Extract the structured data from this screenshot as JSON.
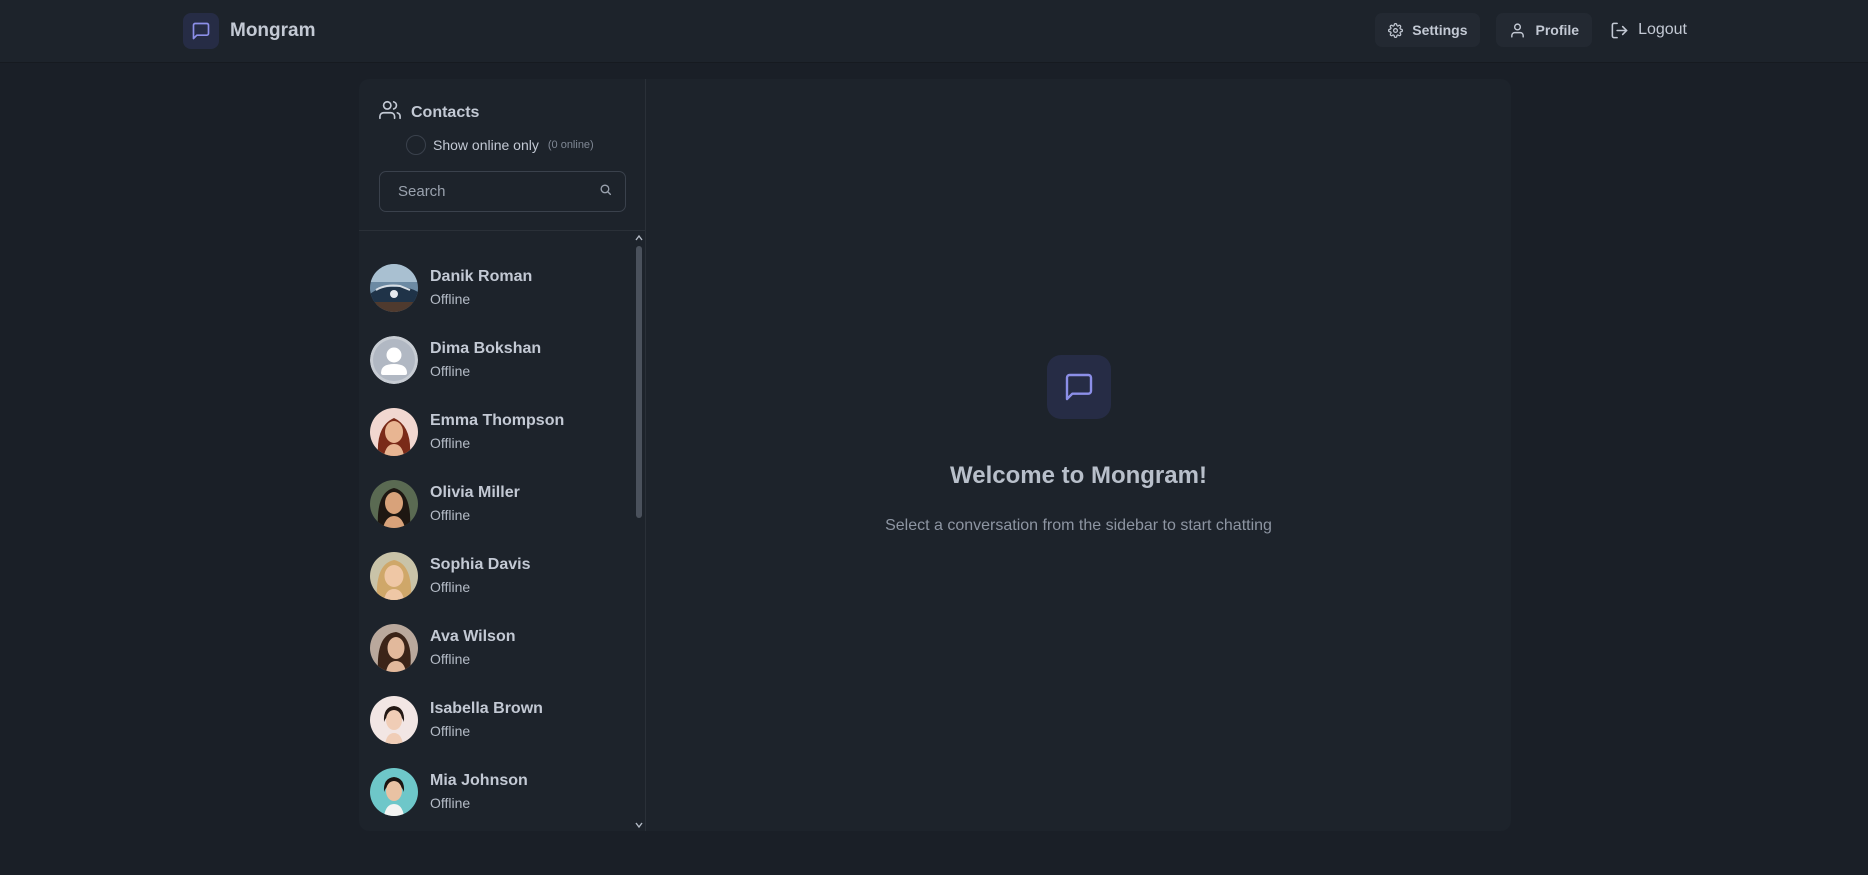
{
  "app": {
    "name": "Mongram",
    "accent_color": "#8c8fe8",
    "icon": "message-square-icon"
  },
  "navbar": {
    "settings": {
      "label": "Settings",
      "icon": "gear-icon"
    },
    "profile": {
      "label": "Profile",
      "icon": "user-icon"
    },
    "logout": {
      "label": "Logout",
      "icon": "logout-icon"
    }
  },
  "sidebar": {
    "title": "Contacts",
    "title_icon": "users-icon",
    "online_filter": {
      "label": "Show online only",
      "count": "(0 online)",
      "checked": false
    },
    "search": {
      "placeholder": "Search",
      "value": "",
      "icon": "search-icon"
    },
    "contacts": [
      {
        "name": "Danik Roman",
        "status": "Offline",
        "avatar": "photo-car"
      },
      {
        "name": "Dima Bokshan",
        "status": "Offline",
        "avatar": "default-user-avatar"
      },
      {
        "name": "Emma Thompson",
        "status": "Offline",
        "avatar": "photo-woman-red-hair"
      },
      {
        "name": "Olivia Miller",
        "status": "Offline",
        "avatar": "photo-woman-dark-hair"
      },
      {
        "name": "Sophia Davis",
        "status": "Offline",
        "avatar": "photo-woman-blonde"
      },
      {
        "name": "Ava Wilson",
        "status": "Offline",
        "avatar": "photo-woman-brown-hair"
      },
      {
        "name": "Isabella Brown",
        "status": "Offline",
        "avatar": "photo-woman-light-background"
      },
      {
        "name": "Mia Johnson",
        "status": "Offline",
        "avatar": "photo-woman-teal-background"
      }
    ]
  },
  "chat": {
    "welcome_title": "Welcome to Mongram!",
    "welcome_subtitle": "Select a conversation from the sidebar to start chatting",
    "icon": "message-square-icon"
  }
}
